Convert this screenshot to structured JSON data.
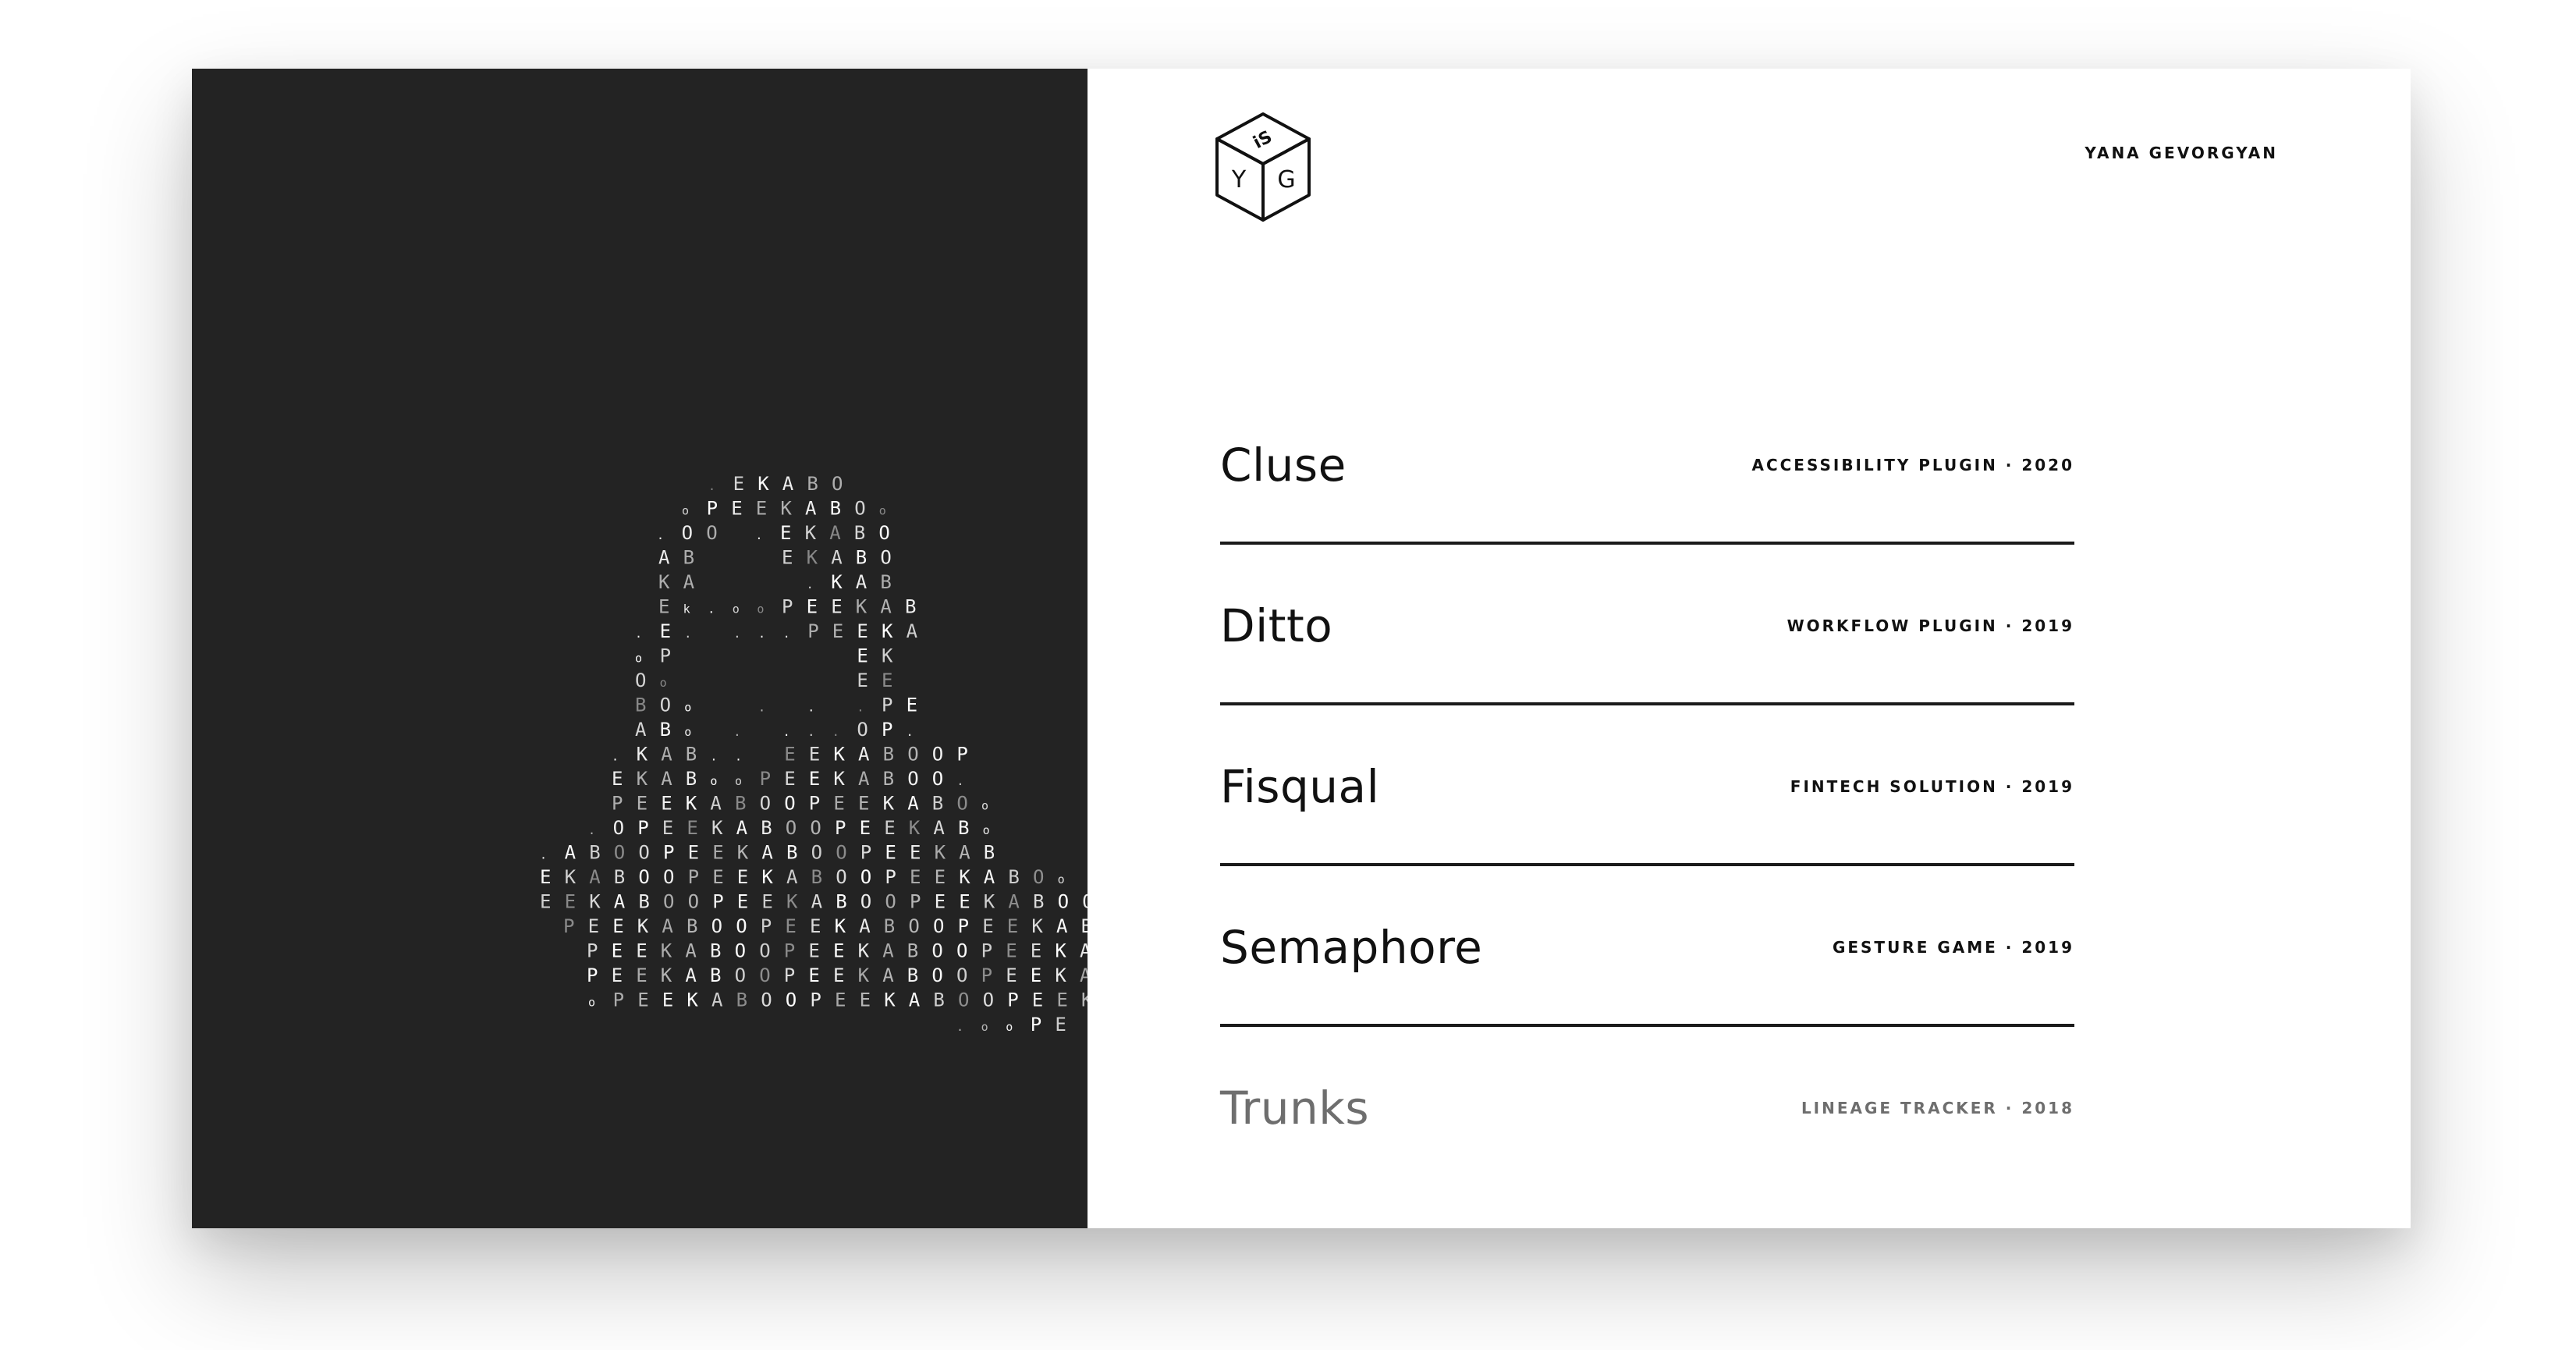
{
  "author": {
    "name": "YANA GEVORGYAN"
  },
  "logo": {
    "letters": [
      "Y",
      "G",
      "iS"
    ],
    "icon": "cube-logo-icon"
  },
  "hero": {
    "icon": "letter-a-typographic-art",
    "art_rows": [
      ". E K A B O",
      "o P E E K A B O o",
      ". O O   . E K A B O",
      "A B       E K A B O",
      "K A         . K A B",
      "E k . o o P E E K A B",
      ". E .   . . . P E E K A",
      "o P               E K",
      "O o               E E",
      "B O o     .   .   . P E",
      "A B o   .   . . . O P .",
      ". K A B . .   E E K A B O O P",
      "E K A B o o P E E K A B O O .",
      "P E E K A B O O P E E K A B O o",
      ". O P E E K A B O O P E E K A B o",
      ". A B O O P E E K A B O O P E E K A B",
      "E K A B O O P E E K A B O O P E E K A B O o",
      "E E K A B O O P E E K A B O O P E E K A B O O",
      "P E E K A B O O P E E K A B O O P E E K A B O O",
      "P E E K A B O O P E E K A B O O P E E K A B O",
      "P E E K A B O O P E E K A B O O P E E K A .",
      "o P E E K A B O O P E E K A B O O P E E K",
      ". o o P E"
    ]
  },
  "projects": [
    {
      "name": "Cluse",
      "meta": "ACCESSIBILITY PLUGIN · 2020"
    },
    {
      "name": "Ditto",
      "meta": "WORKFLOW PLUGIN · 2019"
    },
    {
      "name": "Fisqual",
      "meta": "FINTECH SOLUTION · 2019"
    },
    {
      "name": "Semaphore",
      "meta": "GESTURE GAME · 2019"
    },
    {
      "name": "Trunks",
      "meta": "LINEAGE TRACKER · 2018"
    }
  ],
  "colors": {
    "panel_dark": "#232323",
    "text": "#111111",
    "muted": "#6e6e6e"
  }
}
